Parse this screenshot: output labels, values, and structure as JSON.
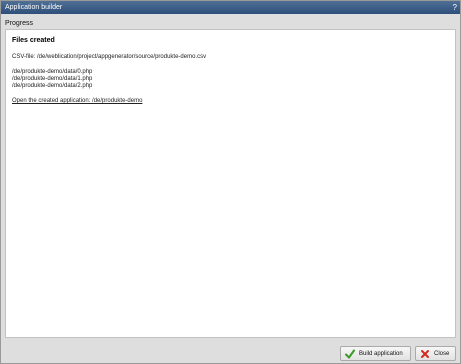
{
  "window": {
    "title": "Application builder",
    "help": "?"
  },
  "progress": {
    "label": "Progress"
  },
  "panel": {
    "title": "Files created",
    "csv_line": "CSV-file: /de/weblication/project/appgenerator/source/produkte-demo.csv",
    "files": [
      "/de/produkte-demo/data/0.php",
      "/de/produkte-demo/data/1.php",
      "/de/produkte-demo/data/2.php"
    ],
    "open_link": "Open the created application: /de/produkte-demo"
  },
  "footer": {
    "build_label": "Build application",
    "close_label": "Close"
  },
  "colors": {
    "titlebar": "#2e4f7a",
    "build_icon": "#3a9a2a",
    "close_icon": "#d12a1e"
  },
  "icons": {
    "build": "checkmark-icon",
    "close": "close-x-icon"
  }
}
